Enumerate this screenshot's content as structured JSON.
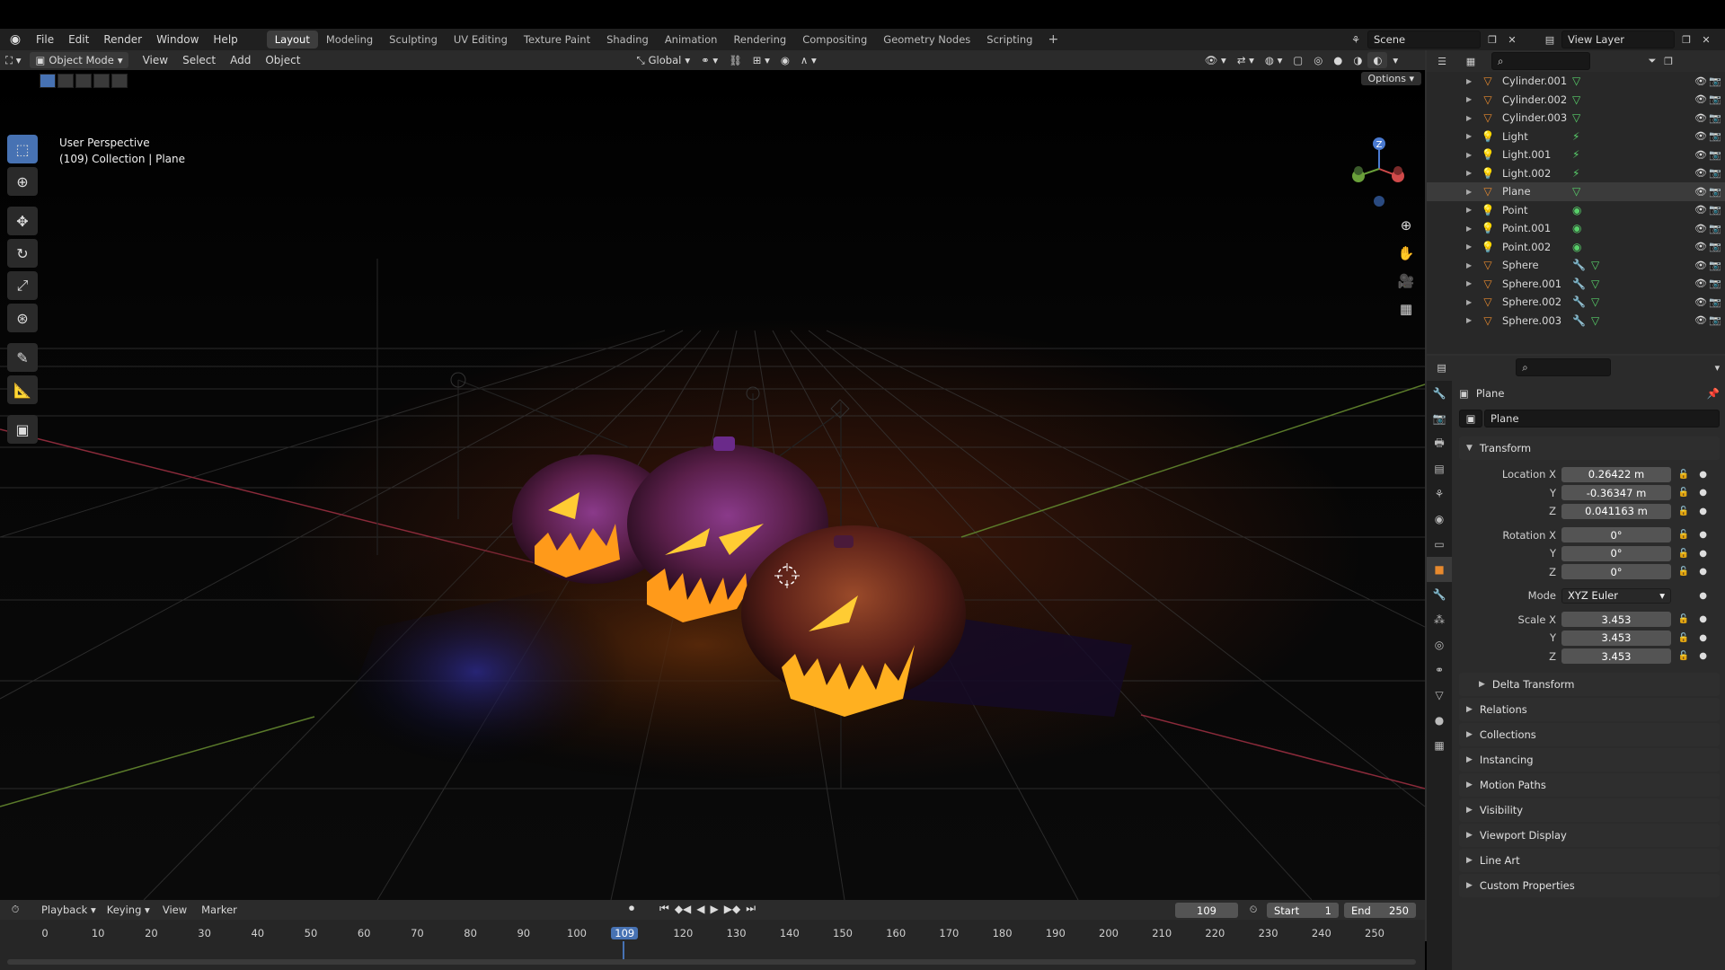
{
  "menu": [
    "File",
    "Edit",
    "Render",
    "Window",
    "Help"
  ],
  "workspaces": [
    "Layout",
    "Modeling",
    "Sculpting",
    "UV Editing",
    "Texture Paint",
    "Shading",
    "Animation",
    "Rendering",
    "Compositing",
    "Geometry Nodes",
    "Scripting"
  ],
  "active_workspace": "Layout",
  "scene": "Scene",
  "view_layer": "View Layer",
  "viewport_header": {
    "mode": "Object Mode",
    "menus": [
      "View",
      "Select",
      "Add",
      "Object"
    ],
    "orientation": "Global",
    "options": "Options"
  },
  "viewport": {
    "perspective": "User Perspective",
    "collection_info": "(109) Collection | Plane",
    "gizmo_z": "Z"
  },
  "outliner": {
    "rows": [
      {
        "name": "Cylinder.001",
        "icon": "mesh",
        "data": "mesh-data-icon",
        "mod": ""
      },
      {
        "name": "Cylinder.002",
        "icon": "mesh",
        "data": "mesh-data-icon",
        "mod": ""
      },
      {
        "name": "Cylinder.003",
        "icon": "mesh",
        "data": "mesh-data-icon",
        "mod": ""
      },
      {
        "name": "Light",
        "icon": "light",
        "data": "light-data-icon",
        "mod": ""
      },
      {
        "name": "Light.001",
        "icon": "light",
        "data": "light-data-icon",
        "mod": ""
      },
      {
        "name": "Light.002",
        "icon": "light",
        "data": "light-data-icon",
        "mod": ""
      },
      {
        "name": "Plane",
        "icon": "mesh",
        "data": "mesh-data-icon",
        "mod": ""
      },
      {
        "name": "Point",
        "icon": "light",
        "data": "point-data-icon",
        "mod": ""
      },
      {
        "name": "Point.001",
        "icon": "light",
        "data": "point-data-icon",
        "mod": ""
      },
      {
        "name": "Point.002",
        "icon": "light",
        "data": "point-data-icon",
        "mod": ""
      },
      {
        "name": "Sphere",
        "icon": "mesh",
        "data": "mesh-data-icon",
        "mod": "wrench"
      },
      {
        "name": "Sphere.001",
        "icon": "mesh",
        "data": "mesh-data-icon",
        "mod": "wrench"
      },
      {
        "name": "Sphere.002",
        "icon": "mesh",
        "data": "mesh-data-icon",
        "mod": "wrench"
      },
      {
        "name": "Sphere.003",
        "icon": "mesh",
        "data": "mesh-data-icon",
        "mod": "wrench"
      }
    ]
  },
  "properties": {
    "object_title": "Plane",
    "object_name": "Plane",
    "transform_title": "Transform",
    "location": {
      "label": "Location X",
      "x": "0.26422 m",
      "y": "-0.36347 m",
      "z": "0.041163 m"
    },
    "rotation": {
      "label": "Rotation X",
      "x": "0°",
      "y": "0°",
      "z": "0°"
    },
    "axis_y": "Y",
    "axis_z": "Z",
    "mode_label": "Mode",
    "mode_value": "XYZ Euler",
    "scale": {
      "label": "Scale X",
      "x": "3.453",
      "y": "3.453",
      "z": "3.453"
    },
    "delta": "Delta Transform",
    "panels": [
      "Relations",
      "Collections",
      "Instancing",
      "Motion Paths",
      "Visibility",
      "Viewport Display",
      "Line Art",
      "Custom Properties"
    ]
  },
  "timeline": {
    "menus": [
      "Playback",
      "Keying",
      "View",
      "Marker"
    ],
    "current_frame": "109",
    "start_label": "Start",
    "start": "1",
    "end_label": "End",
    "end": "250",
    "ticks": [
      "0",
      "10",
      "20",
      "30",
      "40",
      "50",
      "60",
      "70",
      "80",
      "90",
      "100",
      "120",
      "130",
      "140",
      "150",
      "160",
      "170",
      "180",
      "190",
      "200",
      "210",
      "220",
      "230",
      "240",
      "250"
    ]
  }
}
